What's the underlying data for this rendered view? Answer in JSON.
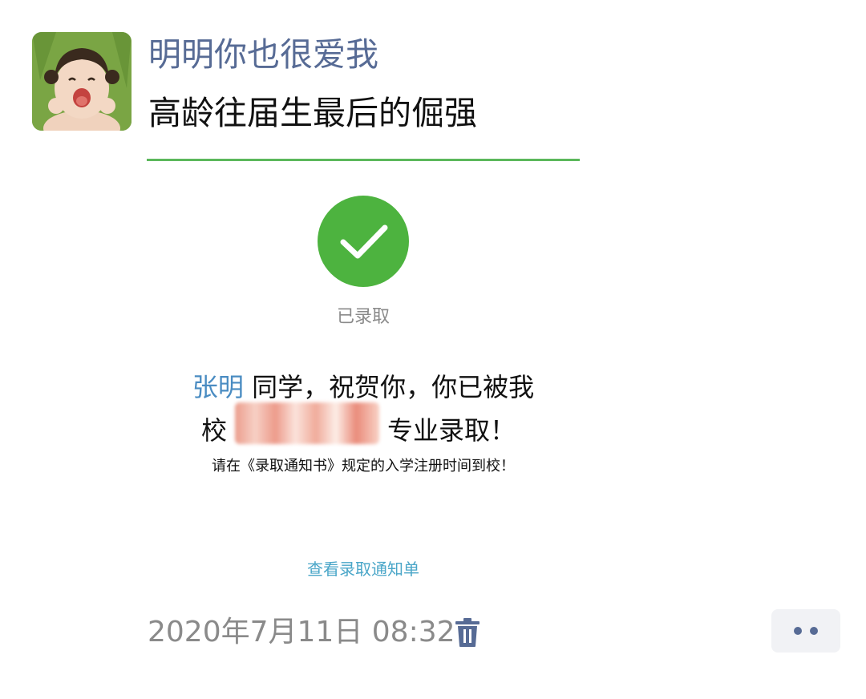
{
  "post": {
    "author_name": "明明你也很爱我",
    "text": "高龄往届生最后的倔强",
    "timestamp": "2020年7月11日 08:32"
  },
  "card": {
    "status_label": "已录取",
    "student_name": "张明",
    "congrats_text": " 同学，祝贺你，你已被我",
    "school_char": "校",
    "major_text": "专业录取！",
    "instruction": "请在《录取通知书》规定的入学注册时间到校！",
    "view_link": "查看录取通知单"
  },
  "icons": {
    "avatar": "avatar-photo",
    "check": "checkmark-icon",
    "trash": "trash-icon",
    "more": "more-dots-icon"
  },
  "colors": {
    "author_link": "#576b95",
    "check_green": "#4db33f",
    "card_line": "#5cb85c",
    "link_blue": "#4aa6c8",
    "name_blue": "#4a8cc2",
    "timestamp_gray": "#8a8a8a"
  }
}
